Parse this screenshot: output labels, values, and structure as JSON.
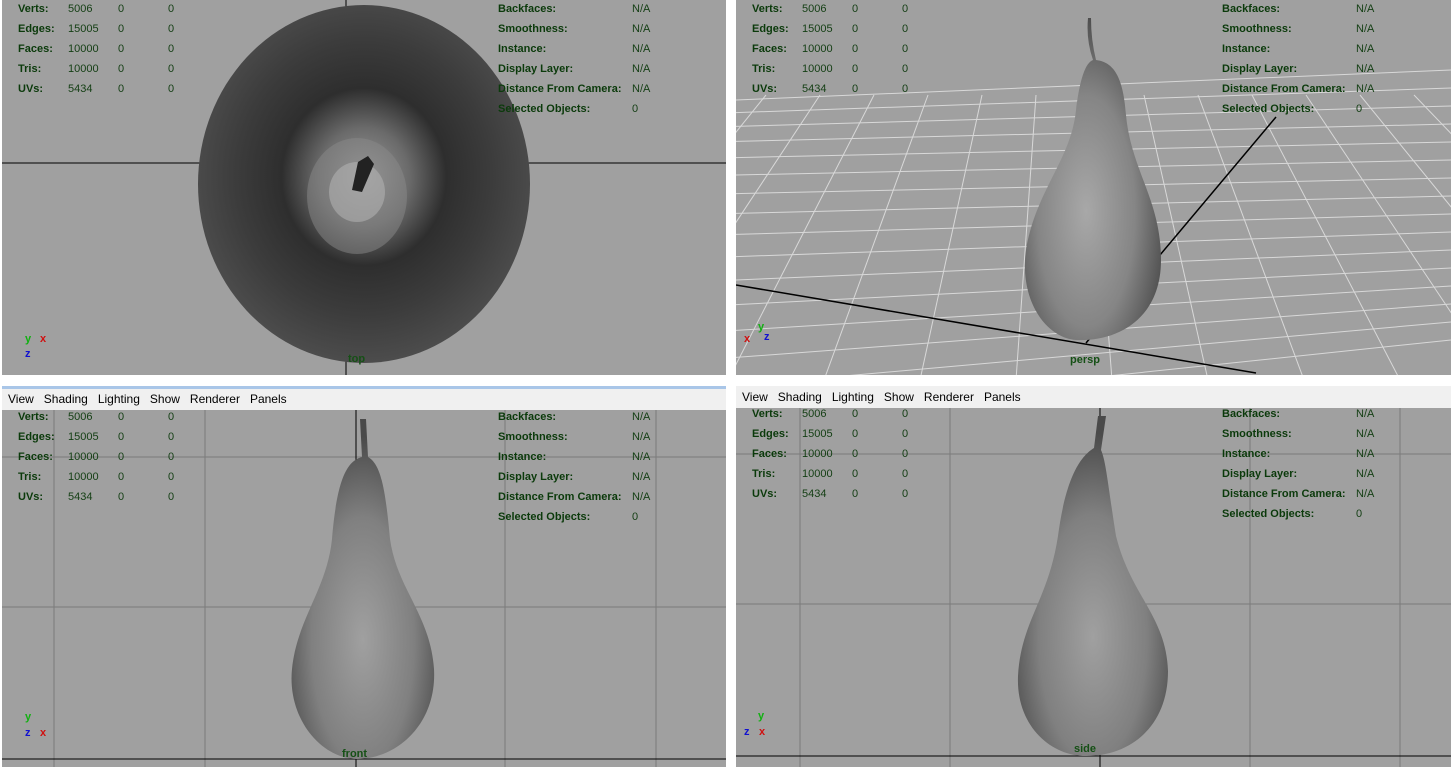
{
  "menu": [
    "View",
    "Shading",
    "Lighting",
    "Show",
    "Renderer",
    "Panels"
  ],
  "stats": [
    {
      "label": "Verts:",
      "values": [
        "5006",
        "0",
        "0"
      ]
    },
    {
      "label": "Edges:",
      "values": [
        "15005",
        "0",
        "0"
      ]
    },
    {
      "label": "Faces:",
      "values": [
        "10000",
        "0",
        "0"
      ]
    },
    {
      "label": "Tris:",
      "values": [
        "10000",
        "0",
        "0"
      ]
    },
    {
      "label": "UVs:",
      "values": [
        "5434",
        "0",
        "0"
      ]
    }
  ],
  "info": [
    {
      "label": "Backfaces:",
      "value": "N/A"
    },
    {
      "label": "Smoothness:",
      "value": "N/A"
    },
    {
      "label": "Instance:",
      "value": "N/A"
    },
    {
      "label": "Display Layer:",
      "value": "N/A"
    },
    {
      "label": "Distance From Camera:",
      "value": "N/A"
    },
    {
      "label": "Selected Objects:",
      "value": "0"
    }
  ],
  "viewports": {
    "top": {
      "camera": "top"
    },
    "persp": {
      "camera": "persp"
    },
    "front": {
      "camera": "front"
    },
    "side": {
      "camera": "side"
    }
  },
  "axes": {
    "x": "x",
    "y": "y",
    "z": "z"
  },
  "colors": {
    "viewport_bg": "#a0a0a0",
    "hud_text": "#0b3a0b",
    "axis_x": "#d01010",
    "axis_y": "#10b010",
    "axis_z": "#1010d0"
  }
}
